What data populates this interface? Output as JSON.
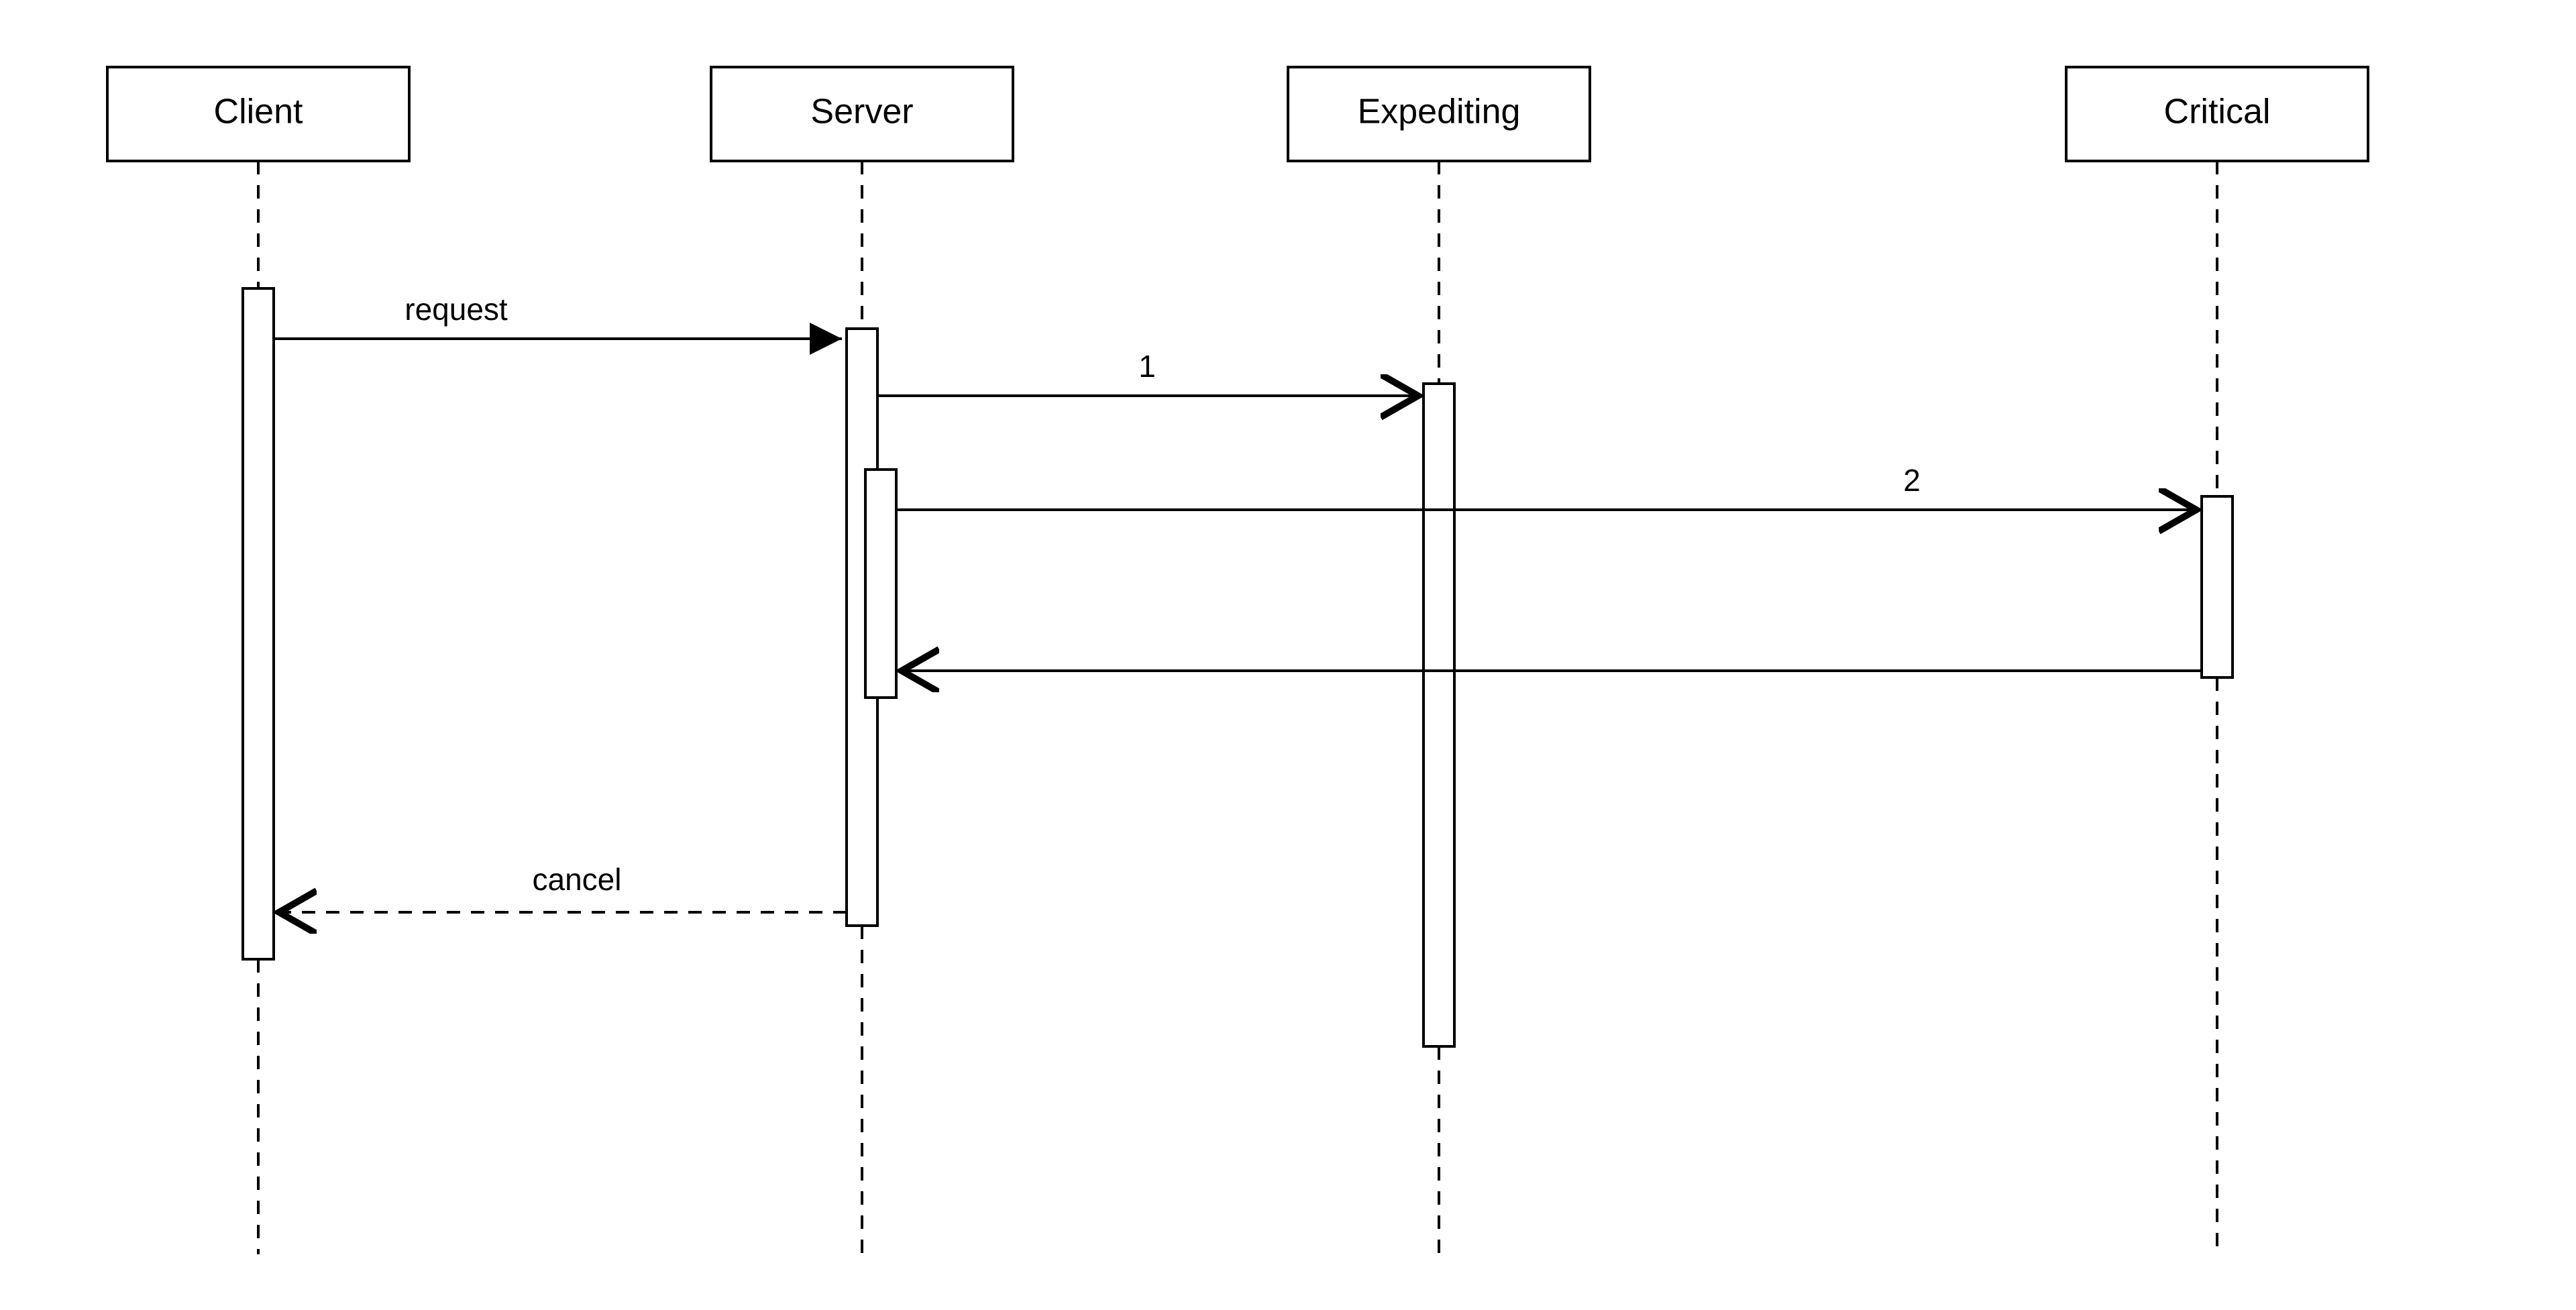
{
  "participants": {
    "client": {
      "label": "Client"
    },
    "server": {
      "label": "Server"
    },
    "expediting": {
      "label": "Expediting"
    },
    "critical": {
      "label": "Critical"
    }
  },
  "messages": {
    "request": {
      "label": "request"
    },
    "msg1": {
      "label": "1"
    },
    "msg2": {
      "label": "2"
    },
    "cancel": {
      "label": "cancel"
    }
  }
}
